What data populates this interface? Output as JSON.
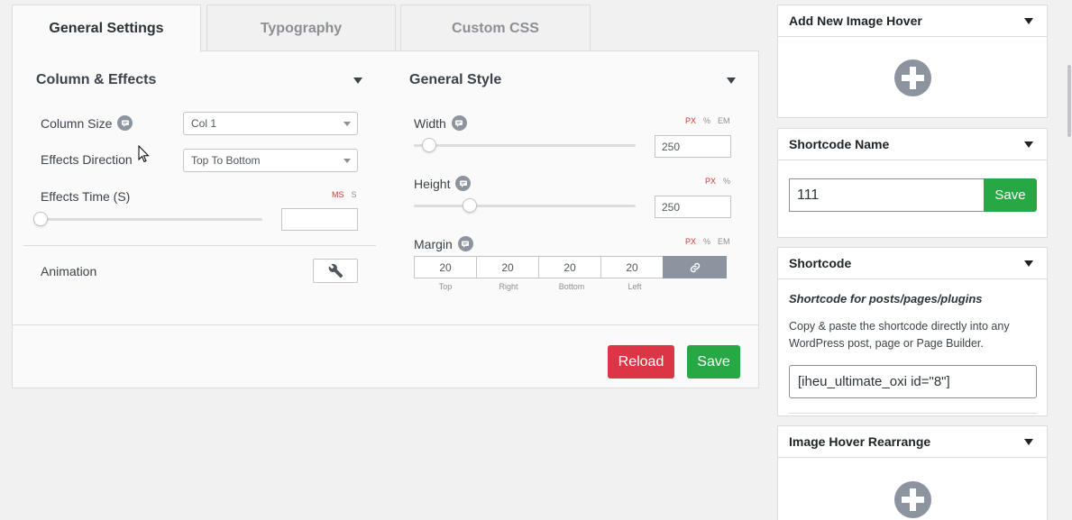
{
  "tabs": {
    "general": "General Settings",
    "typography": "Typography",
    "custom_css": "Custom CSS"
  },
  "column_effects": {
    "title": "Column & Effects",
    "column_size_label": "Column Size",
    "column_size_value": "Col 1",
    "effects_direction_label": "Effects Direction",
    "effects_direction_value": "Top To Bottom",
    "effects_time_label": "Effects Time (S)",
    "effects_time_units": [
      "MS",
      "S"
    ],
    "effects_time_value": "",
    "effects_time_slider": 0,
    "animation_label": "Animation"
  },
  "general_style": {
    "title": "General Style",
    "width_label": "Width",
    "width_units": [
      "PX",
      "%",
      "EM"
    ],
    "width_value": "250",
    "width_slider": 0.07,
    "height_label": "Height",
    "height_units": [
      "PX",
      "%"
    ],
    "height_value": "250",
    "height_slider": 0.25,
    "margin_label": "Margin",
    "margin_units": [
      "PX",
      "%",
      "EM"
    ],
    "margin_values": [
      "20",
      "20",
      "20",
      "20"
    ],
    "margin_captions": [
      "Top",
      "Right",
      "Bottom",
      "Left"
    ]
  },
  "actions": {
    "reload": "Reload",
    "save": "Save"
  },
  "sidebar": {
    "add_new": {
      "title": "Add New Image Hover"
    },
    "shortcode_name": {
      "title": "Shortcode Name",
      "value": "111",
      "save": "Save"
    },
    "shortcode": {
      "title": "Shortcode",
      "subtitle": "Shortcode for posts/pages/plugins",
      "description": "Copy & paste the shortcode directly into any WordPress post, page or Page Builder.",
      "code": "[iheu_ultimate_oxi id=\"8\"]"
    },
    "rearrange": {
      "title": "Image Hover Rearrange"
    }
  },
  "icons": [
    "help-icon",
    "wrench-icon",
    "link-icon",
    "plus-circle-icon",
    "caret-down-icon",
    "mouse-cursor-icon"
  ],
  "colors": {
    "danger": "#dc3545",
    "success": "#28a745",
    "unit_active": "#d63638",
    "icon_gray": "#8c959f"
  }
}
